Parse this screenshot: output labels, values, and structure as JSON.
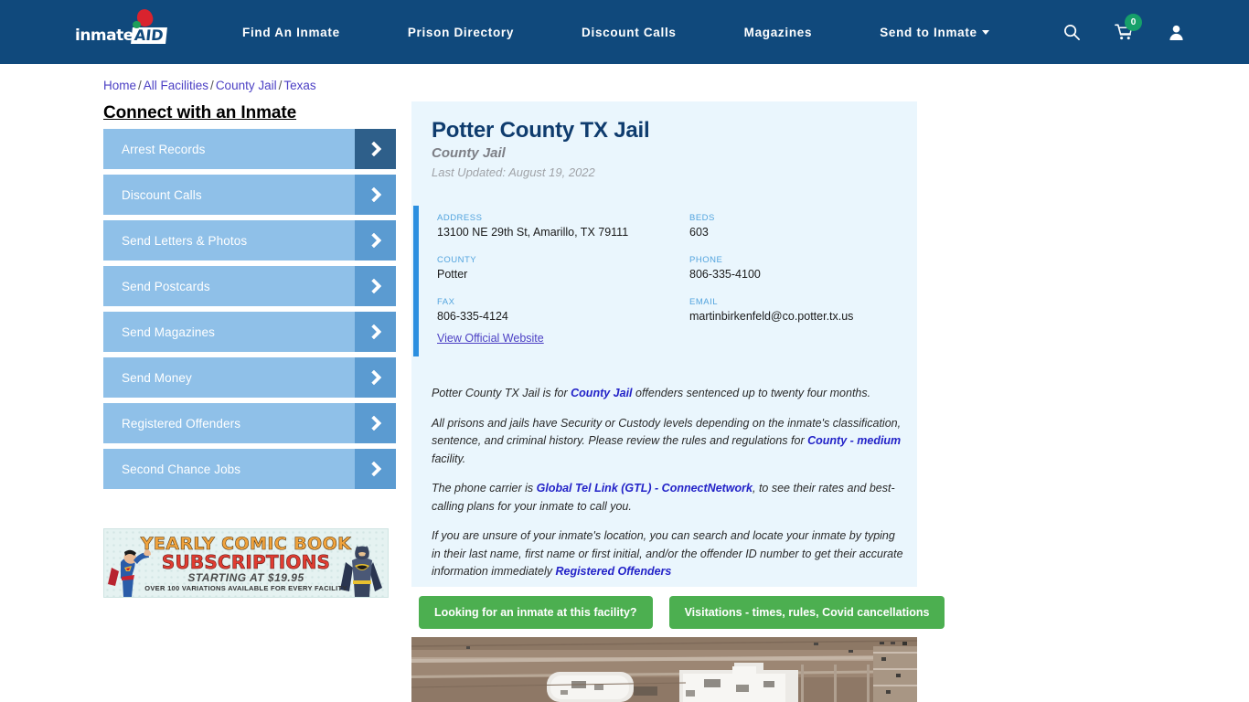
{
  "header": {
    "logo": {
      "part1": "inmate",
      "part2": "AID"
    },
    "nav": [
      {
        "label": "Find An Inmate",
        "name": "nav-find-an-inmate",
        "dropdown": false
      },
      {
        "label": "Prison Directory",
        "name": "nav-prison-directory",
        "dropdown": false
      },
      {
        "label": "Discount Calls",
        "name": "nav-discount-calls",
        "dropdown": false
      },
      {
        "label": "Magazines",
        "name": "nav-magazines",
        "dropdown": false
      },
      {
        "label": "Send to Inmate",
        "name": "nav-send-to-inmate",
        "dropdown": true
      }
    ],
    "icons": {
      "search": "search-icon",
      "cart": "cart-icon",
      "account": "user-icon"
    },
    "cart_count": "0",
    "colors": {
      "bar": "#10497c",
      "cart_badge": "#16a06a"
    }
  },
  "breadcrumb": {
    "items": [
      "Home",
      "All Facilities",
      "County Jail",
      "Texas"
    ],
    "separator": "/"
  },
  "sidebar": {
    "title": "Connect with an Inmate",
    "items": [
      {
        "label": "Arrest Records"
      },
      {
        "label": "Discount Calls"
      },
      {
        "label": "Send Letters & Photos"
      },
      {
        "label": "Send Postcards"
      },
      {
        "label": "Send Magazines"
      },
      {
        "label": "Send Money"
      },
      {
        "label": "Registered Offenders"
      },
      {
        "label": "Second Chance Jobs"
      }
    ]
  },
  "ad": {
    "line1": "YEARLY COMIC BOOK",
    "line2": "SUBSCRIPTIONS",
    "line3": "STARTING AT $19.95",
    "line4": "OVER 100 VARIATIONS AVAILABLE FOR EVERY FACILITY"
  },
  "facility": {
    "title": "Potter County TX Jail",
    "subtitle": "County Jail",
    "last_updated": "Last Updated: August 19, 2022",
    "fields": [
      {
        "label": "ADDRESS",
        "value": "13100 NE 29th St, Amarillo, TX 79111"
      },
      {
        "label": "BEDS",
        "value": "603"
      },
      {
        "label": "COUNTY",
        "value": "Potter"
      },
      {
        "label": "PHONE",
        "value": "806-335-4100"
      },
      {
        "label": "FAX",
        "value": "806-335-4124"
      },
      {
        "label": "EMAIL",
        "value": "martinbirkenfeld@co.potter.tx.us"
      }
    ],
    "official_website_link": "View Official Website"
  },
  "description": {
    "p1_before": "Potter County TX Jail is for ",
    "p1_link": "County Jail",
    "p1_after": " offenders sentenced up to twenty four months.",
    "p2_before": "All prisons and jails have Security or Custody levels depending on the inmate's classification, sentence, and criminal history. Please review the rules and regulations for ",
    "p2_link": "County - medium",
    "p2_after": " facility.",
    "p3_before": "The phone carrier is ",
    "p3_link": "Global Tel Link (GTL) - ConnectNetwork",
    "p3_after": ", to see their rates and best-calling plans for your inmate to call you.",
    "p4_before": "If you are unsure of your inmate's location, you can search and locate your inmate by typing in their last name, first name or first initial, and/or the offender ID number to get their accurate information immediately ",
    "p4_link": "Registered Offenders"
  },
  "actions": {
    "inmate_search_label": "Looking for an inmate at this facility?",
    "visitations_label": "Visitations - times, rules, Covid cancellations",
    "color": "#4caf50"
  },
  "aerial": {
    "alt": "aerial-view-of-potter-county-tx-jail"
  }
}
